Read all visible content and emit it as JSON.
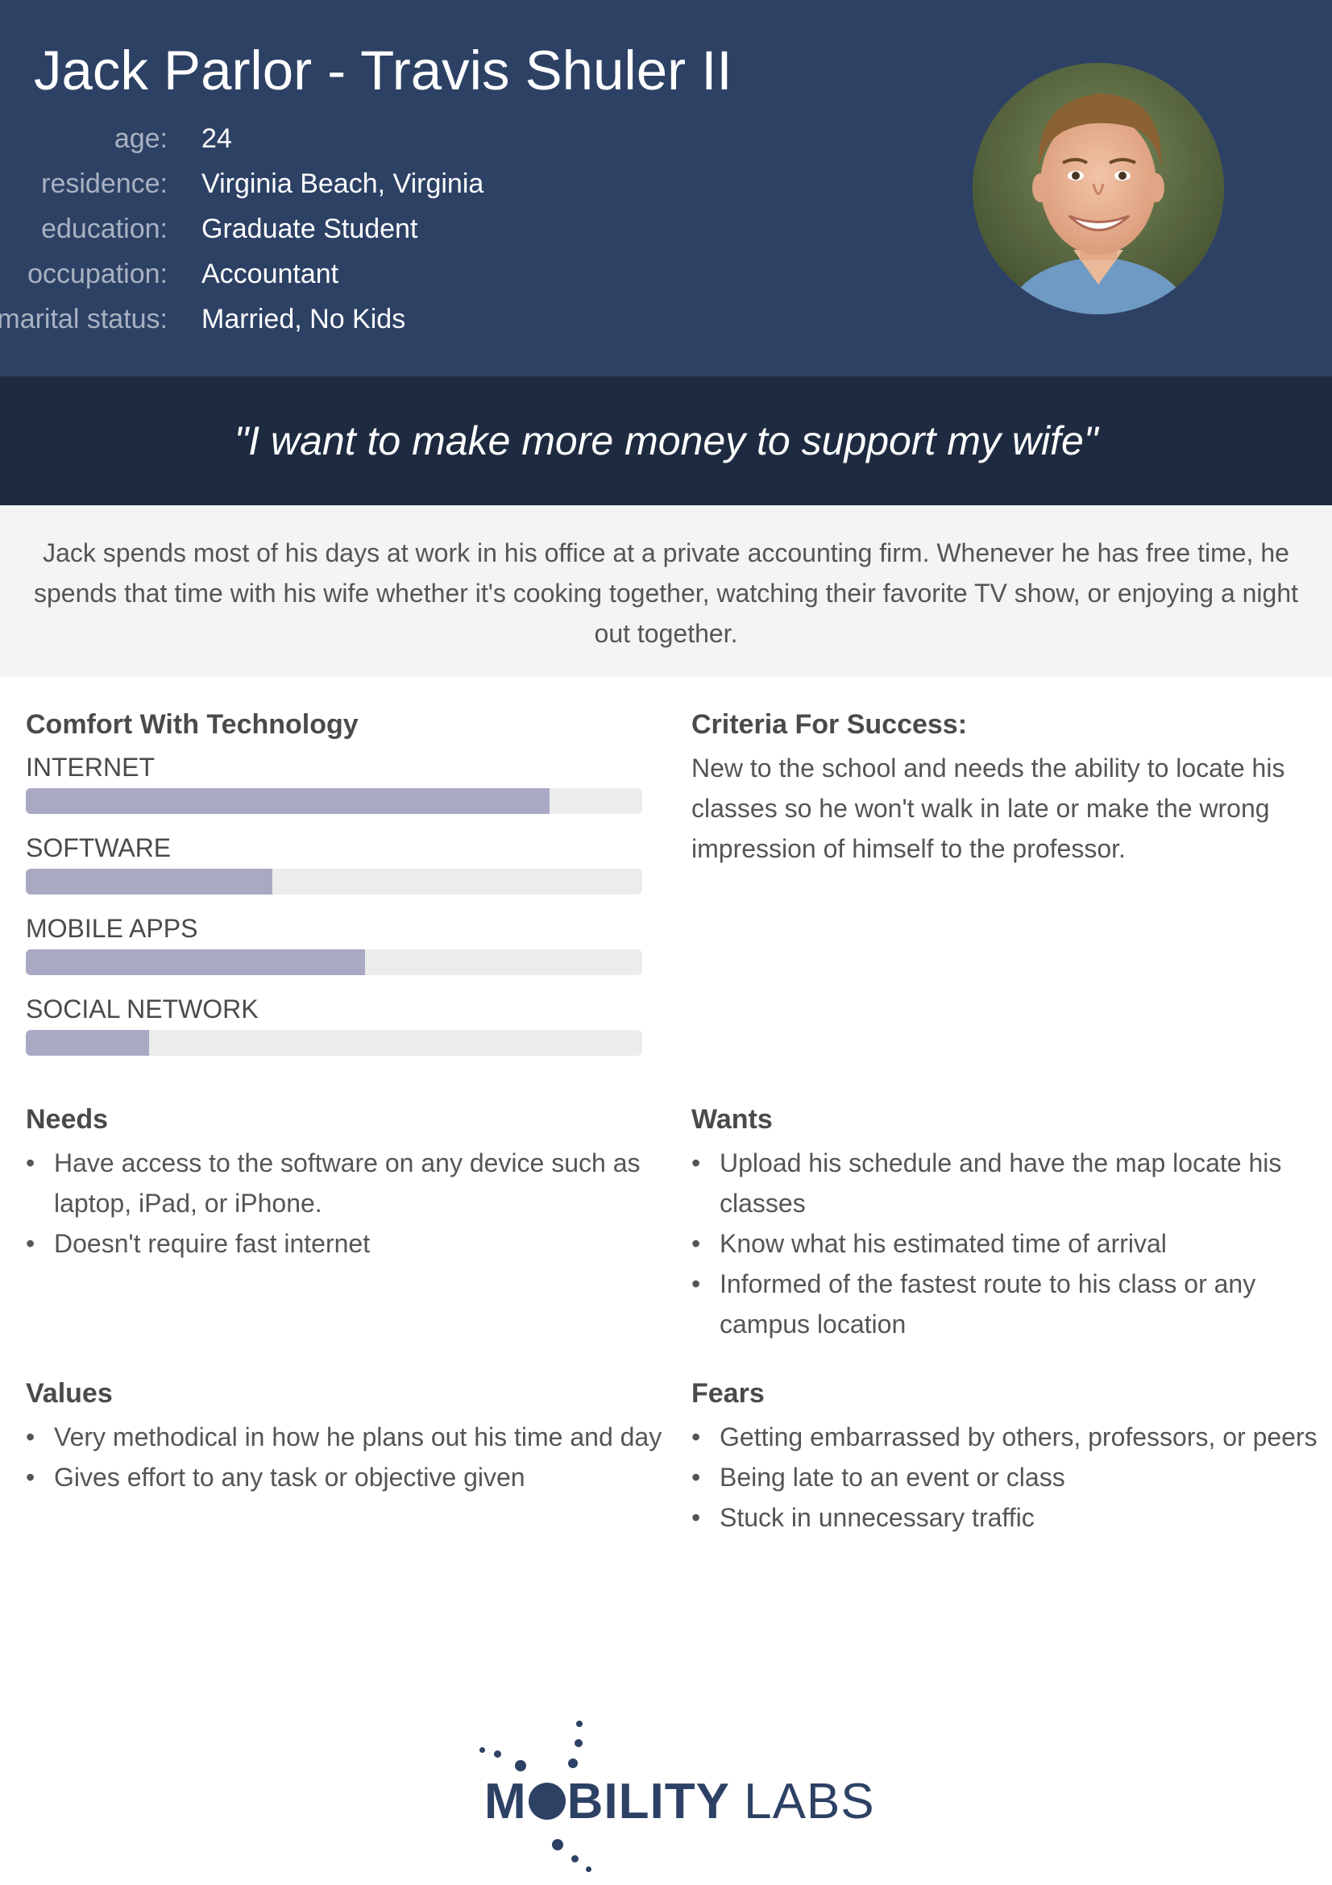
{
  "persona": {
    "name": "Jack Parlor - Travis Shuler II",
    "facts": [
      {
        "label": "age:",
        "value": "24"
      },
      {
        "label": "residence:",
        "value": "Virginia Beach, Virginia"
      },
      {
        "label": "education:",
        "value": "Graduate Student"
      },
      {
        "label": "occupation:",
        "value": "Accountant"
      },
      {
        "label": "marital status:",
        "value": "Married, No Kids"
      }
    ],
    "quote": "\"I want to make more money to support my wife\"",
    "summary": "Jack spends most of his days at work in his office at a private accounting firm. Whenever he has free time, he spends that time with his wife whether it's cooking together, watching their favorite TV show, or enjoying a night out together."
  },
  "comfort": {
    "title": "Comfort With Technology",
    "items": [
      {
        "label": "INTERNET",
        "level": 0.85
      },
      {
        "label": "SOFTWARE",
        "level": 0.4
      },
      {
        "label": "MOBILE APPS",
        "level": 0.55
      },
      {
        "label": "SOCIAL NETWORK",
        "level": 0.2
      }
    ]
  },
  "criteria": {
    "title": "Criteria For Success:",
    "text": "New to the school and needs the ability to locate his classes so he won't walk in late or make the wrong impression of himself to the professor."
  },
  "needs": {
    "title": "Needs",
    "items": [
      "Have access to the software on any device such as laptop, iPad, or iPhone.",
      "Doesn't require fast internet"
    ]
  },
  "wants": {
    "title": "Wants",
    "items": [
      "Upload his schedule and have the map locate his classes",
      "Know what his estimated time of arrival",
      "Informed of the fastest route to his class or any campus location"
    ]
  },
  "values": {
    "title": "Values",
    "items": [
      "Very methodical in how he plans out his time and day",
      "Gives effort to any task or objective given"
    ]
  },
  "fears": {
    "title": "Fears",
    "items": [
      "Getting embarrassed by others, professors, or peers",
      "Being late to an event or class",
      "Stuck in unnecessary traffic"
    ]
  },
  "logo": {
    "text_part1": "M",
    "text_part2": "BILITY",
    "text_part3": "LABS",
    "color": "#2d4165"
  },
  "colors": {
    "header_bg": "#2d4165",
    "quote_bg": "#1e2a40",
    "bar_fill": "#a9a9c4",
    "bar_track": "#ececec"
  }
}
